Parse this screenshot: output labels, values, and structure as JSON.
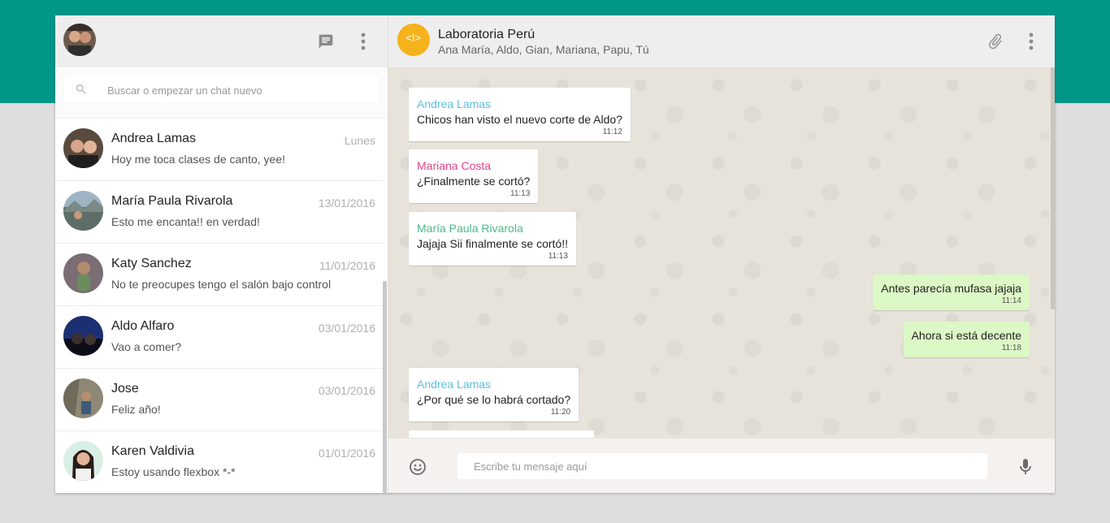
{
  "colors": {
    "teal_band": "#009688",
    "header_bg": "#eeeeee",
    "outgoing_bubble": "#dcf8c6",
    "group_logo": "#f6b21b",
    "author_andrea": "#5bc0de",
    "author_mariana": "#e0448b",
    "author_maria_paula": "#4cb88a"
  },
  "sidebar": {
    "header_icons": [
      "chat-icon",
      "more-vert-icon"
    ],
    "search": {
      "placeholder": "Buscar o empezar un chat nuevo"
    },
    "chats": [
      {
        "name": "Andrea Lamas",
        "date": "Lunes",
        "last_message": "Hoy me toca clases de canto, yee!"
      },
      {
        "name": "María Paula Rivarola",
        "date": "13/01/2016",
        "last_message": "Esto me encanta!! en verdad!"
      },
      {
        "name": "Katy Sanchez",
        "date": "11/01/2016",
        "last_message": "No te preocupes tengo el salón bajo control"
      },
      {
        "name": "Aldo Alfaro",
        "date": "03/01/2016",
        "last_message": "Vao a comer?"
      },
      {
        "name": "Jose",
        "date": "03/01/2016",
        "last_message": "Feliz año!"
      },
      {
        "name": "Karen Valdivia",
        "date": "01/01/2016",
        "last_message": "Estoy usando flexbox *-*"
      }
    ]
  },
  "conversation": {
    "group_logo_text": "<l>",
    "group_name": "Laboratoria Perú",
    "members": "Ana María, Aldo, Gian, Mariana, Papu, Tú",
    "header_icons": [
      "attach-icon",
      "more-vert-icon"
    ],
    "messages": [
      {
        "direction": "in",
        "author": "Andrea Lamas",
        "text": "Chicos han visto el nuevo corte de Aldo?",
        "time": "11:12"
      },
      {
        "direction": "in",
        "author": "Mariana Costa",
        "text": "¿Finalmente se cortó?",
        "time": "11:13"
      },
      {
        "direction": "in",
        "author": "María Paula Rivarola",
        "text": "Jajaja Sii finalmente se cortó!!",
        "time": "11:13"
      },
      {
        "direction": "out",
        "author": "",
        "text": "Antes parecía mufasa jajaja",
        "time": "11:14"
      },
      {
        "direction": "out",
        "author": "",
        "text": "Ahora si está decente",
        "time": "11:18"
      },
      {
        "direction": "in",
        "author": "Andrea Lamas",
        "text": "¿Por qué se lo habrá cortado?",
        "time": "11:20"
      }
    ],
    "composer": {
      "placeholder": "Escribe tu mensaje aquí"
    },
    "composer_icons": [
      "emoji-icon",
      "mic-icon"
    ]
  }
}
